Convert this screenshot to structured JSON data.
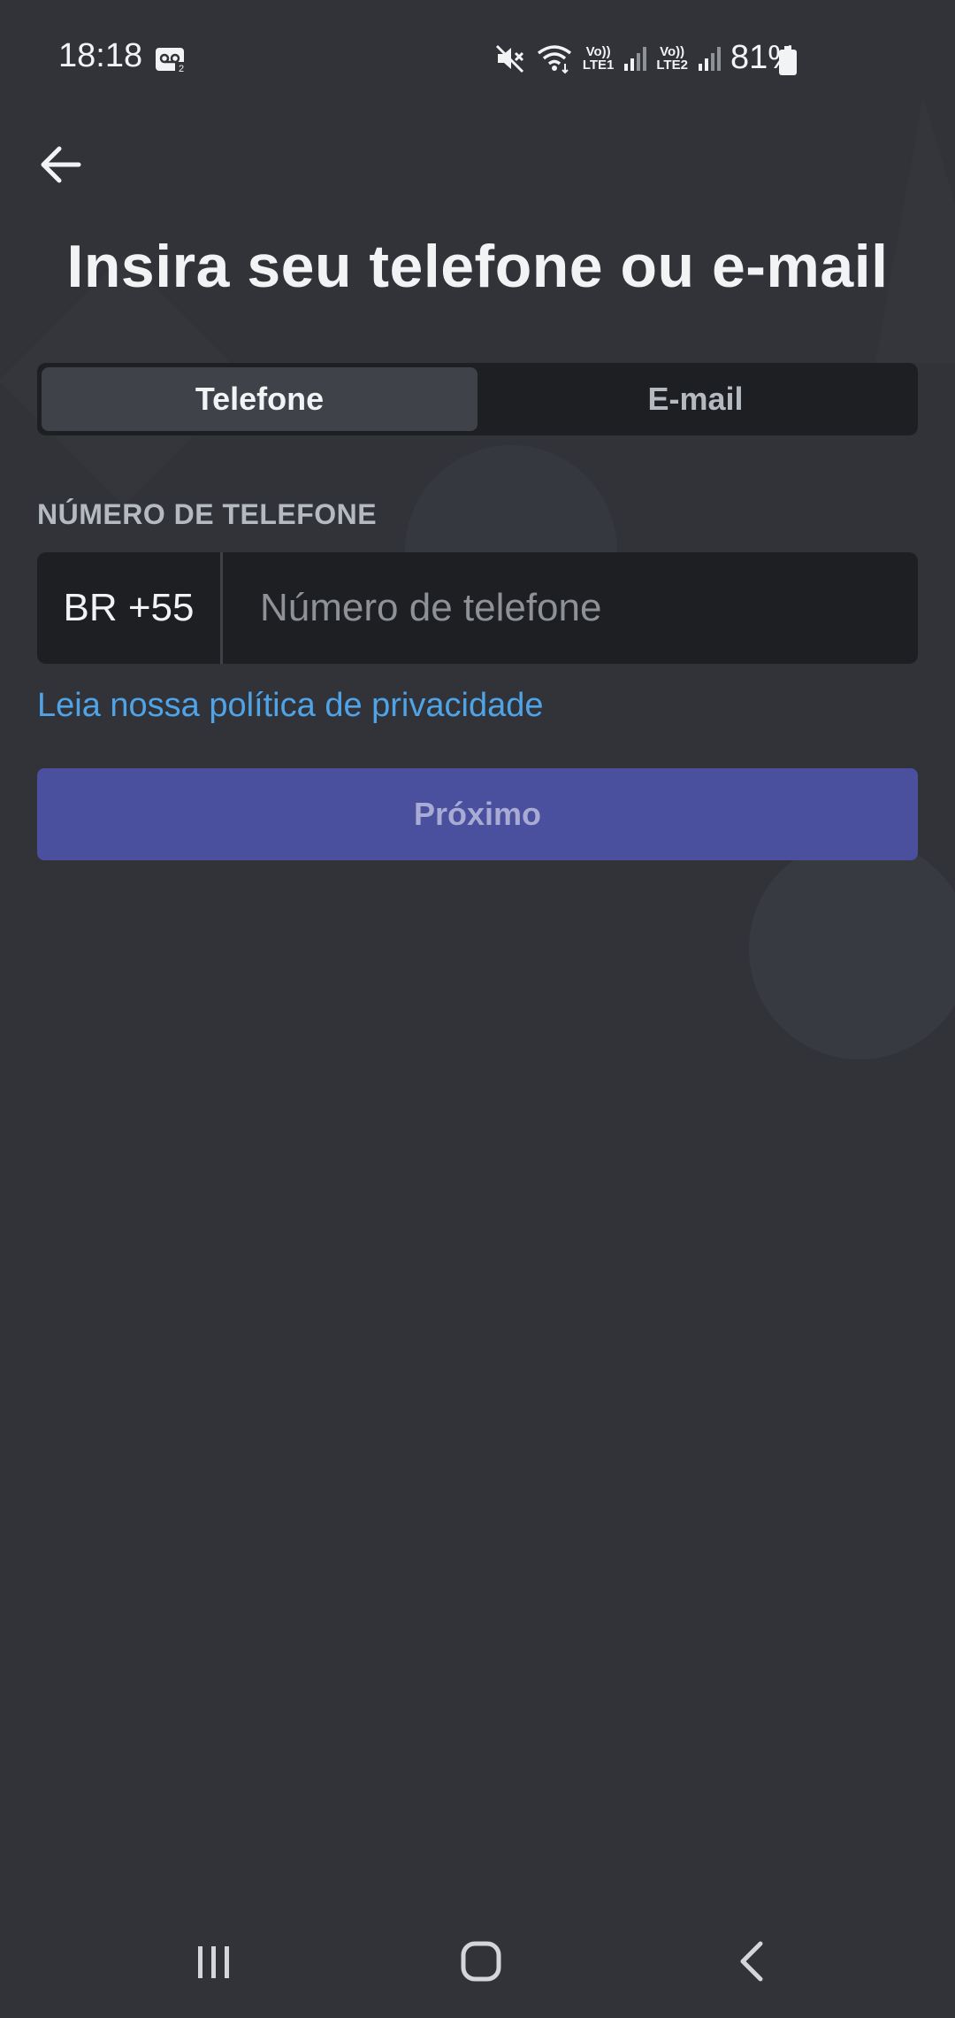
{
  "status_bar": {
    "time": "18:18",
    "battery": "81%",
    "sim1": "LTE1",
    "sim2": "LTE2",
    "volte": "Vo))",
    "icons": [
      "voicemail-icon",
      "mute-icon",
      "wifi-icon",
      "signal-icon",
      "battery-icon"
    ]
  },
  "header": {
    "title": "Insira seu telefone ou e-mail"
  },
  "tabs": [
    {
      "label": "Telefone",
      "active": true
    },
    {
      "label": "E-mail",
      "active": false
    }
  ],
  "form": {
    "label": "NÚMERO DE TELEFONE",
    "country_code": "BR +55",
    "phone_placeholder": "Número de telefone",
    "phone_value": ""
  },
  "privacy_link": "Leia nossa política de privacidade",
  "next_button": "Próximo",
  "colors": {
    "background": "#313338",
    "input_bg": "#1e1f22",
    "accent": "#4a4f9e",
    "link": "#4fa4e8"
  }
}
